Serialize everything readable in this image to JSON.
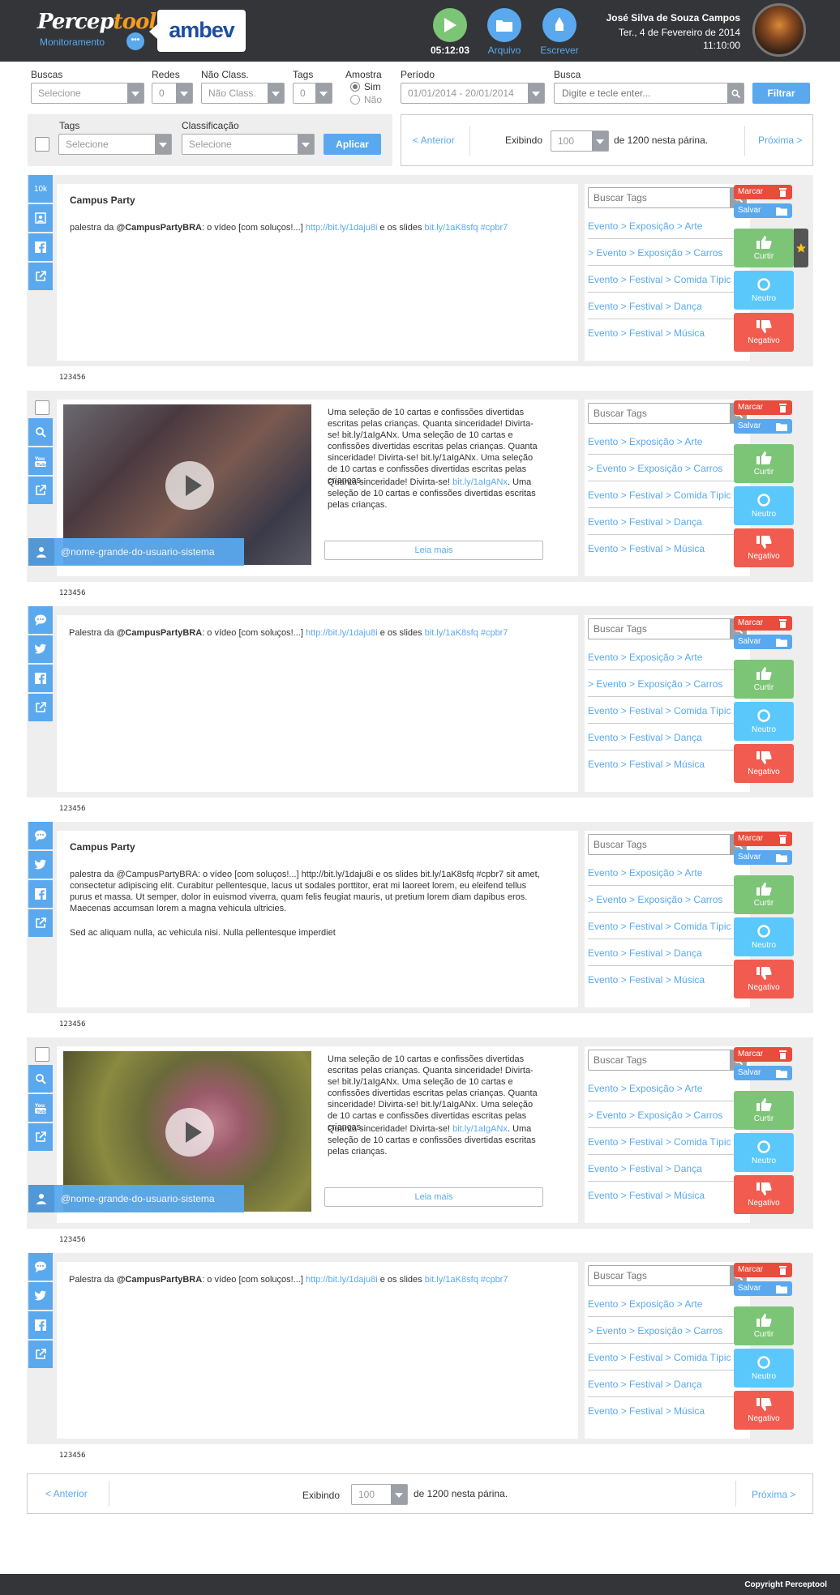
{
  "header": {
    "logo_main": "Percep",
    "logo_accent": "tool",
    "logo_sub": "Monitoramento",
    "dots": "•••",
    "client": "ambev",
    "timer": "05:12:03",
    "arquivo": "Arquivo",
    "escrever": "Escrever",
    "user_name": "José Silva de Souza Campos",
    "user_date": "Ter., 4 de Fevereiro de 2014",
    "user_time": "11:10:00",
    "colors": {
      "play": "#7cc576",
      "arquivo": "#5aa9ee",
      "escrever": "#5aa9ee"
    }
  },
  "filters": {
    "buscas_label": "Buscas",
    "buscas_value": "Selecione",
    "redes_label": "Redes",
    "redes_value": "0",
    "naoclass_label": "Não Class.",
    "naoclass_value": "Não Class.",
    "tags_label": "Tags",
    "tags_value": "0",
    "amostra_label": "Amostra",
    "amostra_sim": "Sim",
    "amostra_nao": "Não",
    "periodo_label": "Período",
    "periodo_value": "01/01/2014 - 20/01/2014",
    "busca_label": "Busca",
    "busca_placeholder": "Digite e tecle enter...",
    "filtrar": "Filtrar"
  },
  "bulk": {
    "tags_label": "Tags",
    "tags_value": "Selecione",
    "class_label": "Classificação",
    "class_value": "Selecione",
    "aplicar": "Aplicar"
  },
  "pager": {
    "anterior": "< Anterior",
    "exibindo": "Exibindo",
    "per_page": "100",
    "suffix": "de 1200 nesta párina.",
    "proxima": "Próxima >"
  },
  "tag_search_placeholder": "Buscar Tags",
  "tag_list": [
    "Evento > Exposição > Arte",
    "> Evento > Exposição > Carros",
    "Evento > Festival > Comida Típic",
    "Evento > Festival > Dança",
    "Evento > Festival > Música"
  ],
  "actions": {
    "marcar": "Marcar",
    "salvar": "Salvar",
    "curtir": "Curtir",
    "neutro": "Neutro",
    "negativo": "Negativo"
  },
  "posts": [
    {
      "id": "123456",
      "title": "Campus Party",
      "p1": "palestra da ",
      "handle": "@CampusPartyBRA",
      "p2": ": o vídeo [com soluços!...] ",
      "link1": "http://bit.ly/1daju8i",
      "p3": " e os slides ",
      "link2": "bit.ly/1aK8sfq #cpbr7",
      "side_count": "10k"
    },
    {
      "id": "123456",
      "text1": "Uma seleção de 10 cartas e confissões divertidas escritas pelas crianças. Quanta sinceridade! Divirta-se! bit.ly/1aIgANx. Uma seleção de 10 cartas e confissões divertidas escritas pelas crianças. Quanta sinceridade! Divirta-se! bit.ly/1aIgANx. Uma seleção de 10 cartas e confissões divertidas escritas pelas crianças.",
      "text2a": "Quanta sinceridade! Divirta-se! ",
      "text2link": "bit.ly/1aIgANx",
      "text2b": ". Uma seleção de 10 cartas e confissões divertidas escritas pelas crianças.",
      "leia": "Leia mais",
      "user": "@nome-grande-do-usuario-sistema"
    },
    {
      "id": "123456",
      "p1": "Palestra da ",
      "handle": "@CampusPartyBRA",
      "p2": ": o vídeo [com soluços!...] ",
      "link1": "http://bit.ly/1daju8i",
      "p3": " e os slides ",
      "link2": "bit.ly/1aK8sfq #cpbr7"
    },
    {
      "id": "123456",
      "title": "Campus Party",
      "body1": "palestra da @CampusPartyBRA: o vídeo [com soluços!...] http://bit.ly/1daju8i e os slides bit.ly/1aK8sfq #cpbr7 sit amet, consectetur adipiscing elit. Curabitur pellentesque, lacus ut sodales porttitor, erat mi laoreet lorem, eu eleifend tellus purus et massa. Ut semper, dolor in euismod viverra, quam felis feugiat mauris, ut pretium lorem diam dapibus eros. Maecenas accumsan lorem a magna vehicula ultricies.",
      "body2": "Sed ac aliquam nulla, ac vehicula nisi. Nulla pellentesque imperdiet"
    },
    {
      "id": "123456",
      "text1": "Uma seleção de 10 cartas e confissões divertidas escritas pelas crianças. Quanta sinceridade! Divirta-se! bit.ly/1aIgANx. Uma seleção de 10 cartas e confissões divertidas escritas pelas crianças. Quanta sinceridade! Divirta-se! bit.ly/1aIgANx. Uma seleção de 10 cartas e confissões divertidas escritas pelas crianças.",
      "text2a": "Quanta sinceridade! Divirta-se! ",
      "text2link": "bit.ly/1aIgANx",
      "text2b": ". Uma seleção de 10 cartas e confissões divertidas escritas pelas crianças.",
      "leia": "Leia mais",
      "user": "@nome-grande-do-usuario-sistema"
    },
    {
      "id": "123456",
      "p1": "Palestra da ",
      "handle": "@CampusPartyBRA",
      "p2": ": o vídeo [com soluços!...] ",
      "link1": "http://bit.ly/1daju8i",
      "p3": " e os slides ",
      "link2": "bit.ly/1aK8sfq #cpbr7"
    }
  ],
  "footer": {
    "copyright": "Copyright Perceptool"
  }
}
